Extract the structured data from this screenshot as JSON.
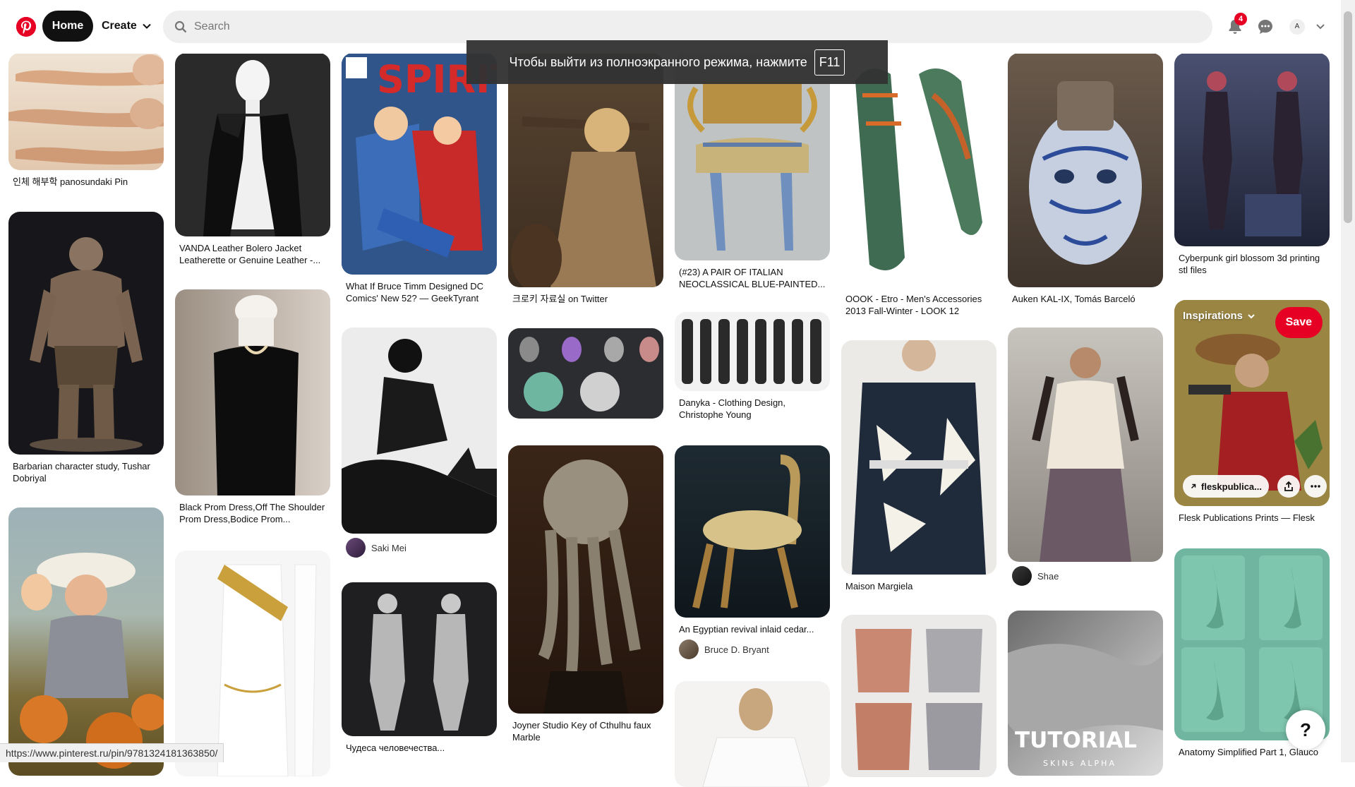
{
  "header": {
    "home_label": "Home",
    "create_label": "Create",
    "search_placeholder": "Search",
    "notification_count": "4",
    "avatar_initial": "A"
  },
  "fullscreen_notice": {
    "text": "Чтобы выйти из полноэкранного режима, нажмите",
    "key": "F11"
  },
  "pins": {
    "col1": [
      {
        "caption": "인체 해부학 panosundaki Pin",
        "image": "anatomy-arms-studies"
      },
      {
        "caption": "Barbarian character study, Tushar Dobriyal",
        "image": "barbarian-sculpture"
      },
      {
        "caption": "",
        "image": "pinup-pumpkin-illustration"
      }
    ],
    "col2": [
      {
        "caption": "VANDA Leather Bolero Jacket Leatherette or Genuine Leather -...",
        "image": "leather-bolero-mannequin"
      },
      {
        "caption": "Black Prom Dress,Off The Shoulder Prom Dress,Bodice Prom...",
        "image": "black-prom-dress"
      },
      {
        "caption": "",
        "image": "white-drape-gold-belt-mannequin"
      }
    ],
    "col3": [
      {
        "caption": "What If Bruce Timm Designed DC Comics' New 52? — GeekTyrant",
        "image": "spirit-comic-cover"
      },
      {
        "caption": "",
        "by": "Saki Mei",
        "image": "woman-with-doberman"
      },
      {
        "caption": "Чудеса человечества...",
        "image": "elf-3d-sculpt"
      }
    ],
    "col4": [
      {
        "caption": "크로키 자료실 on Twitter",
        "image": "woman-with-rifle"
      },
      {
        "caption": "",
        "image": "hair-sculpting-guide"
      },
      {
        "caption": "Joyner Studio Key of Cthulhu faux Marble",
        "image": "cthulhu-bust"
      }
    ],
    "col5": [
      {
        "caption": "(#23) A PAIR OF ITALIAN NEOCLASSICAL BLUE-PAINTED...",
        "image": "neoclassical-chair"
      },
      {
        "caption": "Danyka - Clothing Design, Christophe Young",
        "image": "clothing-design-lineup"
      },
      {
        "caption": "An Egyptian revival inlaid cedar...",
        "by": "Bruce D. Bryant",
        "image": "egyptian-revival-chair"
      },
      {
        "caption": "",
        "image": "woman-white-blazer"
      }
    ],
    "col6": [
      {
        "caption": "OOOK - Etro - Men's Accessories 2013 Fall-Winter - LOOK 12",
        "image": "etro-shoes"
      },
      {
        "caption": "Maison Margiela",
        "image": "margiela-coat"
      },
      {
        "caption": "",
        "image": "torso-anatomy-renders"
      }
    ],
    "col7": [
      {
        "caption": "Auken KAL-IX, Tomás Barceló",
        "image": "blue-porcelain-mask"
      },
      {
        "caption": "",
        "by": "Shae",
        "image": "boho-fashion-street"
      },
      {
        "caption": "",
        "image": "tutorial-skin-alpha",
        "overlay_text": "TUTORIAL",
        "overlay_sub": "SKINs ALPHA"
      }
    ],
    "col8": [
      {
        "caption": "Cyberpunk girl blossom 3d printing stl files",
        "image": "cyberpunk-girl-3d"
      },
      {
        "caption": "Flesk Publications Prints — Flesk",
        "image": "flesk-cowgirl-print",
        "hover": {
          "board": "Inspirations",
          "save": "Save",
          "link": "fleskpublica..."
        }
      },
      {
        "caption": "Anatomy Simplified Part 1, Glauco",
        "image": "nose-sculpt-steps"
      }
    ]
  },
  "status_url": "https://www.pinterest.ru/pin/9781324181363850/",
  "help_label": "?",
  "colors": {
    "brand": "#e60023",
    "search_bg": "#efefef",
    "text": "#111111"
  }
}
